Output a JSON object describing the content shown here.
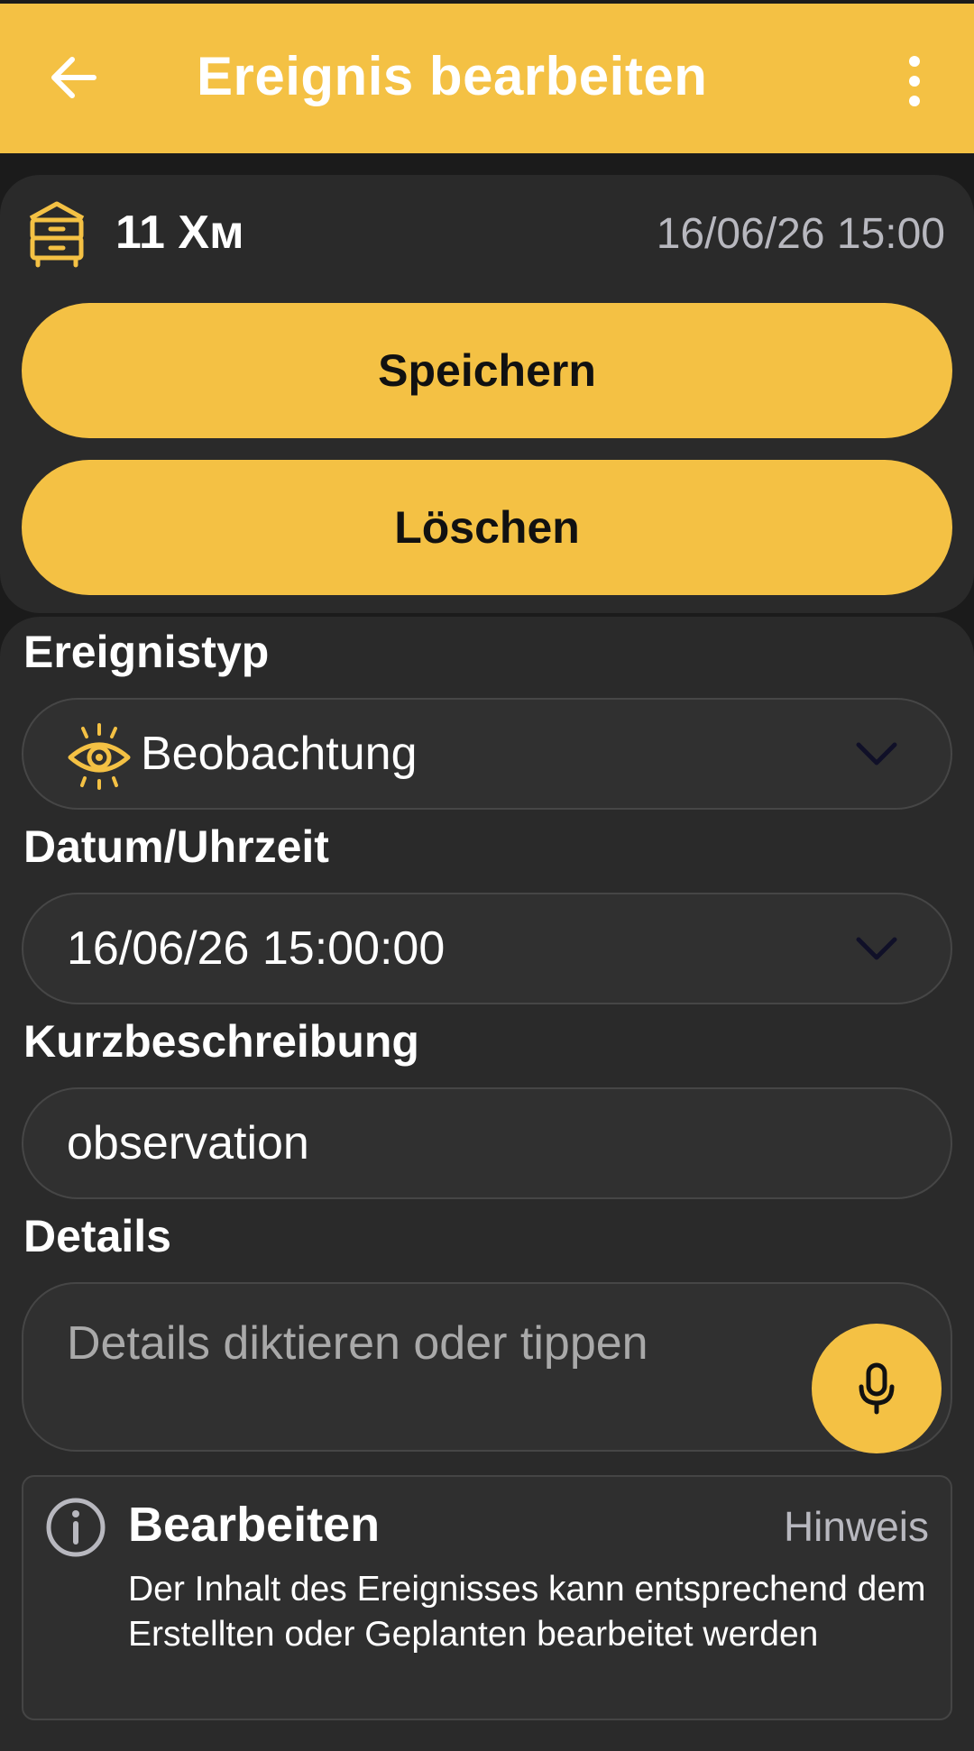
{
  "appbar": {
    "title": "Ereignis bearbeiten"
  },
  "hive": {
    "name": "11 Хм",
    "datetime": "16/06/26 15:00"
  },
  "actions": {
    "save": "Speichern",
    "delete": "Löschen"
  },
  "form": {
    "event_type": {
      "label": "Ereignistyp",
      "value": "Beobachtung",
      "icon": "eye-icon"
    },
    "datetime": {
      "label": "Datum/Uhrzeit",
      "value": "16/06/26 15:00:00"
    },
    "short_desc": {
      "label": "Kurzbeschreibung",
      "value": "observation"
    },
    "details": {
      "label": "Details",
      "value": "",
      "placeholder": "Details diktieren oder tippen"
    }
  },
  "info": {
    "title": "Bearbeiten",
    "badge": "Hinweis",
    "body": "Der Inhalt des Ereignisses kann entsprechend dem Erstellten oder Geplanten bearbeitet werden"
  },
  "colors": {
    "accent": "#f4c144",
    "surface": "#2a2a2a",
    "background": "#1b1b1b"
  }
}
